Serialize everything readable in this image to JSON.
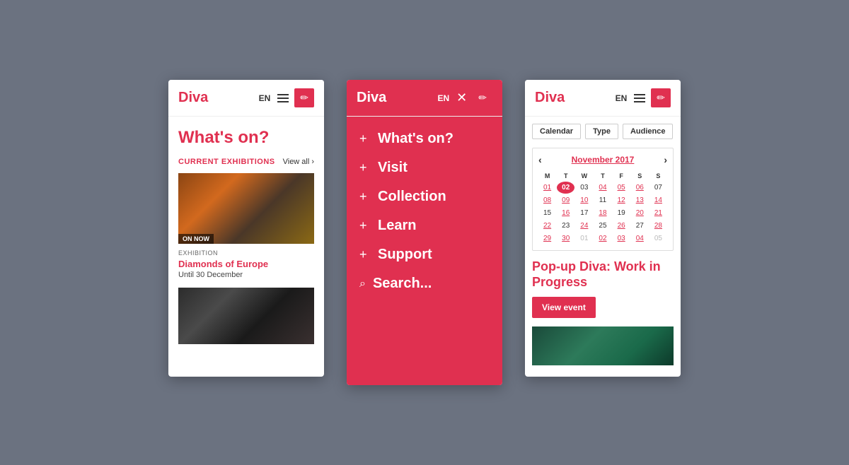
{
  "background": "#6b7280",
  "brand": {
    "accent": "#e03050",
    "name": "Diva"
  },
  "screen1": {
    "lang": "EN",
    "title": "What's on?",
    "section_label": "Current Exhibitions",
    "view_all": "View all",
    "on_now": "ON NOW",
    "exhibit1_type": "EXHIBITION",
    "exhibit1_title": "Diamonds of Europe",
    "exhibit1_date": "Until 30 December"
  },
  "screen2": {
    "lang": "EN",
    "menu_items": [
      {
        "label": "What's on?",
        "icon": "+"
      },
      {
        "label": "Visit",
        "icon": "+"
      },
      {
        "label": "Collection",
        "icon": "+"
      },
      {
        "label": "Learn",
        "icon": "+"
      },
      {
        "label": "Support",
        "icon": "+"
      }
    ],
    "search_label": "Search..."
  },
  "screen3": {
    "lang": "EN",
    "filter_buttons": [
      "Calendar",
      "Type",
      "Audience"
    ],
    "calendar": {
      "month": "November 2017",
      "day_headers": [
        "M",
        "T",
        "W",
        "T",
        "F",
        "S",
        "S"
      ],
      "weeks": [
        [
          {
            "day": "01",
            "type": "link"
          },
          {
            "day": "02",
            "type": "today"
          },
          {
            "day": "03",
            "type": "normal"
          },
          {
            "day": "04",
            "type": "link"
          },
          {
            "day": "05",
            "type": "link"
          },
          {
            "day": "06",
            "type": "link"
          },
          {
            "day": "07",
            "type": "normal"
          }
        ],
        [
          {
            "day": "08",
            "type": "link"
          },
          {
            "day": "09",
            "type": "link"
          },
          {
            "day": "10",
            "type": "link"
          },
          {
            "day": "11",
            "type": "normal"
          },
          {
            "day": "12",
            "type": "link"
          },
          {
            "day": "13",
            "type": "link"
          },
          {
            "day": "14",
            "type": "link"
          }
        ],
        [
          {
            "day": "15",
            "type": "normal"
          },
          {
            "day": "16",
            "type": "link"
          },
          {
            "day": "17",
            "type": "normal"
          },
          {
            "day": "18",
            "type": "link"
          },
          {
            "day": "19",
            "type": "normal"
          },
          {
            "day": "20",
            "type": "link"
          },
          {
            "day": "21",
            "type": "link"
          }
        ],
        [
          {
            "day": "22",
            "type": "link"
          },
          {
            "day": "23",
            "type": "normal"
          },
          {
            "day": "24",
            "type": "link"
          },
          {
            "day": "25",
            "type": "normal"
          },
          {
            "day": "26",
            "type": "link"
          },
          {
            "day": "27",
            "type": "normal"
          },
          {
            "day": "28",
            "type": "link"
          }
        ],
        [
          {
            "day": "29",
            "type": "link"
          },
          {
            "day": "30",
            "type": "link"
          },
          {
            "day": "01",
            "type": "gray"
          },
          {
            "day": "02",
            "type": "link"
          },
          {
            "day": "03",
            "type": "link"
          },
          {
            "day": "04",
            "type": "link"
          },
          {
            "day": "05",
            "type": "gray"
          }
        ]
      ]
    },
    "event_title": "Pop-up Diva: Work in Progress",
    "view_event_btn": "View event"
  }
}
